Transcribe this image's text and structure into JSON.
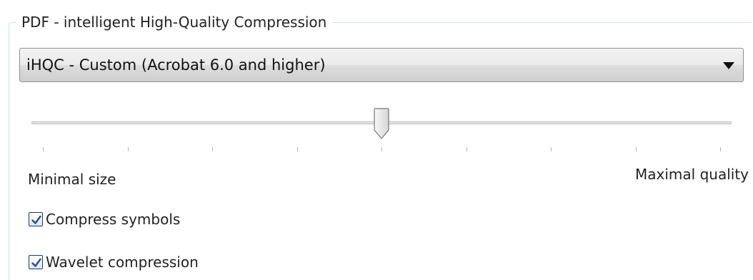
{
  "group": {
    "title": "PDF - intelligent High-Quality Compression"
  },
  "compression_select": {
    "selected": "iHQC - Custom (Acrobat 6.0 and higher)",
    "icon": "chevron-down-icon"
  },
  "quality_slider": {
    "min_label": "Minimal size",
    "max_label": "Maximal quality",
    "value": 4,
    "min": 0,
    "max": 8
  },
  "options": [
    {
      "label": "Compress symbols",
      "checked": true
    },
    {
      "label": "Wavelet compression",
      "checked": true
    }
  ],
  "colors": {
    "checkmark": "#2b4d8c",
    "group_border": "#d5dfe5"
  }
}
